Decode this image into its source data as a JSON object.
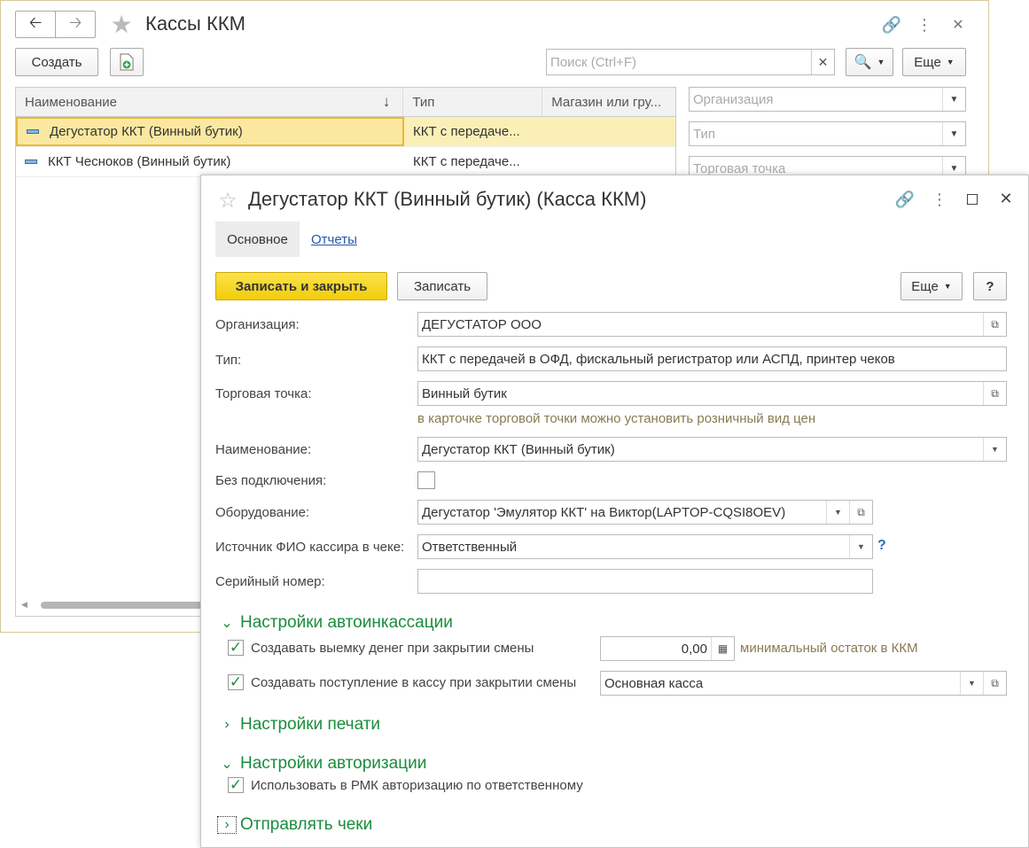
{
  "back_window": {
    "title": "Кассы ККМ",
    "create_label": "Создать",
    "search_placeholder": "Поиск (Ctrl+F)",
    "more_label": "Еще",
    "columns": [
      "Наименование",
      "Тип",
      "Магазин или гру..."
    ],
    "rows": [
      {
        "name": "Дегустатор ККТ (Винный бутик)",
        "type": "ККТ с передаче...",
        "shop": ""
      },
      {
        "name": "ККТ Чесноков (Винный бутик)",
        "type": "ККТ с передаче...",
        "shop": ""
      }
    ],
    "filters": {
      "org_placeholder": "Организация",
      "type_placeholder": "Тип",
      "point_placeholder": "Торговая точка"
    }
  },
  "front_window": {
    "title": "Дегустатор ККТ (Винный бутик) (Касса ККМ)",
    "tabs": [
      "Основное",
      "Отчеты"
    ],
    "save_close_label": "Записать и закрыть",
    "save_label": "Записать",
    "more_label": "Еще",
    "help_label": "?",
    "fields": {
      "org_label": "Организация:",
      "org_value": "ДЕГУСТАТОР ООО",
      "type_label": "Тип:",
      "type_value": "ККТ с передачей в ОФД, фискальный регистратор или АСПД, принтер чеков",
      "point_label": "Торговая точка:",
      "point_value": "Винный бутик",
      "point_hint": "в карточке торговой точки можно установить розничный вид цен",
      "name_label": "Наименование:",
      "name_value": "Дегустатор ККТ (Винный бутик)",
      "offline_label": "Без подключения:",
      "equipment_label": "Оборудование:",
      "equipment_value": "Дегустатор 'Эмулятор ККТ' на Виктор(LAPTOP-CQSI8OEV)",
      "cashier_label": "Источник ФИО кассира в чеке:",
      "cashier_value": "Ответственный",
      "cashier_help": "?",
      "serial_label": "Серийный номер:",
      "serial_value": ""
    },
    "sections": {
      "autocollect": "Настройки автоинкассации",
      "print": "Настройки печати",
      "auth": "Настройки авторизации",
      "send": "Отправлять чеки"
    },
    "autocollect": {
      "withdraw_label": "Создавать выемку денег при закрытии смены",
      "withdraw_checked": true,
      "min_value": "0,00",
      "min_label": "минимальный остаток в ККМ",
      "receipt_label": "Создавать поступление в кассу при закрытии смены",
      "receipt_checked": true,
      "receipt_value": "Основная касса"
    },
    "auth": {
      "use_label": "Использовать в РМК авторизацию по ответственному",
      "use_checked": true
    }
  },
  "colors": {
    "accent_green": "#1a8c3c",
    "selected_row": "#fbefb8",
    "primary_button": "#f5d40f",
    "link_blue": "#2457a6"
  }
}
